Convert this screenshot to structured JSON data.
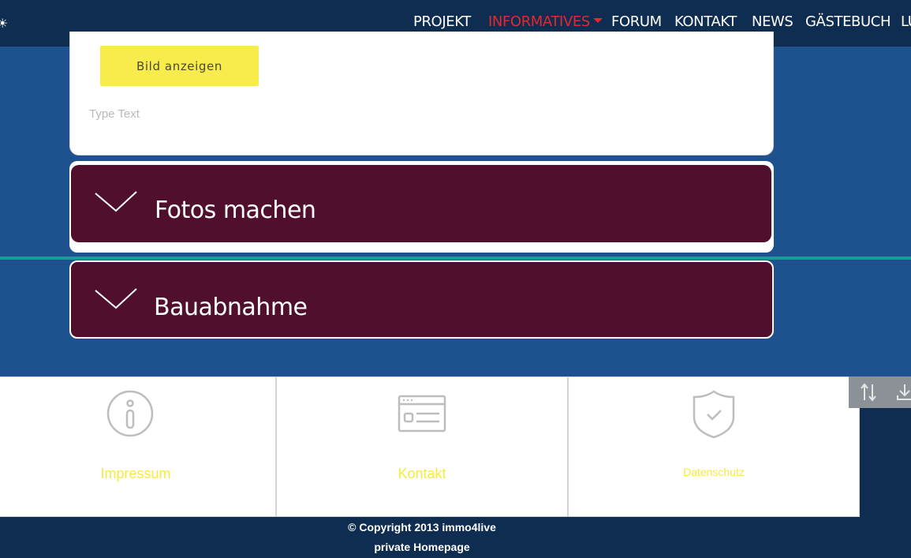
{
  "nav": {
    "logo_fragment": "☀",
    "items": [
      {
        "label": "PROJEKT"
      },
      {
        "label": "INFORMATIVES"
      },
      {
        "label": "FORUM"
      },
      {
        "label": "KONTAKT"
      },
      {
        "label": "NEWS"
      },
      {
        "label": "GÄSTEBUCH"
      },
      {
        "label": "LU"
      }
    ],
    "active_color": "#e4282f"
  },
  "panel": {
    "button_label": "Bild anzeigen",
    "text_placeholder": "Type Text"
  },
  "accordion": [
    {
      "title": "Fotos machen",
      "icon": "chevron-down-icon"
    },
    {
      "title": "Bauabnahme",
      "icon": "chevron-down-icon"
    }
  ],
  "footer": {
    "cards": [
      {
        "label": "Impressum",
        "icon": "info-icon"
      },
      {
        "label": "Kontakt",
        "icon": "contact-card-icon"
      },
      {
        "label": "Datenschutz",
        "icon": "shield-check-icon"
      }
    ],
    "tools": [
      {
        "icon": "sort-icon"
      },
      {
        "icon": "download-icon"
      }
    ],
    "copyright_line1": "© Copyright 2013 immo4live",
    "copyright_line2": "private Homepage"
  },
  "colors": {
    "page_bg": "#1e528e",
    "nav_bg": "#0f2d51",
    "accordion_bg": "#510f2e",
    "button_yellow": "#f7ec4b",
    "link_yellow": "#f6ea3c",
    "teal_divider": "#1d9b97"
  }
}
